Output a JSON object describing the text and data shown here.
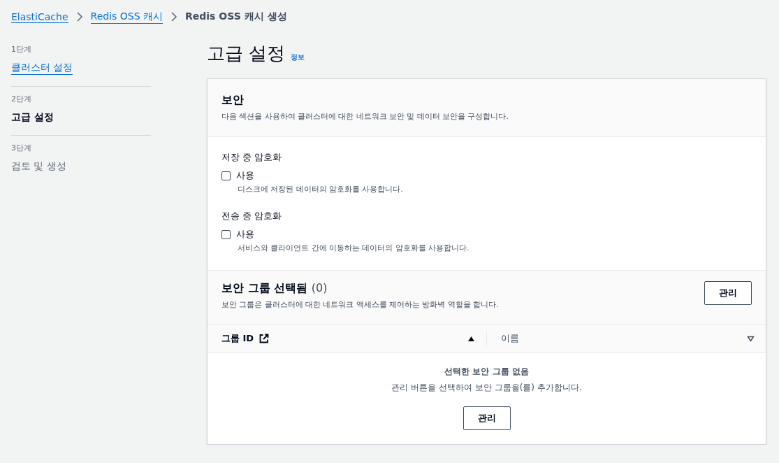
{
  "breadcrumbs": [
    {
      "label": "ElastiCache",
      "link": true
    },
    {
      "label": "Redis OSS 캐시",
      "link": true
    },
    {
      "label": "Redis OSS 캐시 생성",
      "link": false
    }
  ],
  "steps": [
    {
      "step": "1단계",
      "title": "클러스터 설정",
      "completed": true,
      "selected": false
    },
    {
      "step": "2단계",
      "title": "고급 설정",
      "completed": false,
      "selected": true
    },
    {
      "step": "3단계",
      "title": "검토 및 생성",
      "completed": false,
      "selected": false
    }
  ],
  "page": {
    "title": "고급 설정",
    "info_link": "정보"
  },
  "security": {
    "title": "보안",
    "description": "다음 섹션을 사용하여 클러스터에 대한 네트워크 보안 및 데이터 보안을 구성합니다.",
    "options": [
      {
        "label": "저장 중 암호화",
        "checkbox": "사용",
        "checked": false,
        "hint": "디스크에 저장된 데이터의 암호화를 사용합니다."
      },
      {
        "label": "전송 중 암호화",
        "checkbox": "사용",
        "checked": false,
        "hint": "서비스와 클라이언트 간에 이동하는 데이터의 암호화를 사용합니다."
      }
    ]
  },
  "security_groups": {
    "title": "보안 그룹 선택됨",
    "count": "(0)",
    "description": "보안 그룹은 클러스터에 대한 네트워크 액세스를 제어하는 방화벽 역할을 합니다.",
    "manage_button": "관리",
    "columns": [
      {
        "label": "그룹 ID",
        "external_link": true,
        "sorted": true
      },
      {
        "label": "이름",
        "external_link": false,
        "sorted": false
      }
    ],
    "empty": {
      "title": "선택한 보안 그룹 없음",
      "message": "관리 버튼을 선택하여 보안 그룹을(를) 추가합니다.",
      "button": "관리"
    }
  }
}
